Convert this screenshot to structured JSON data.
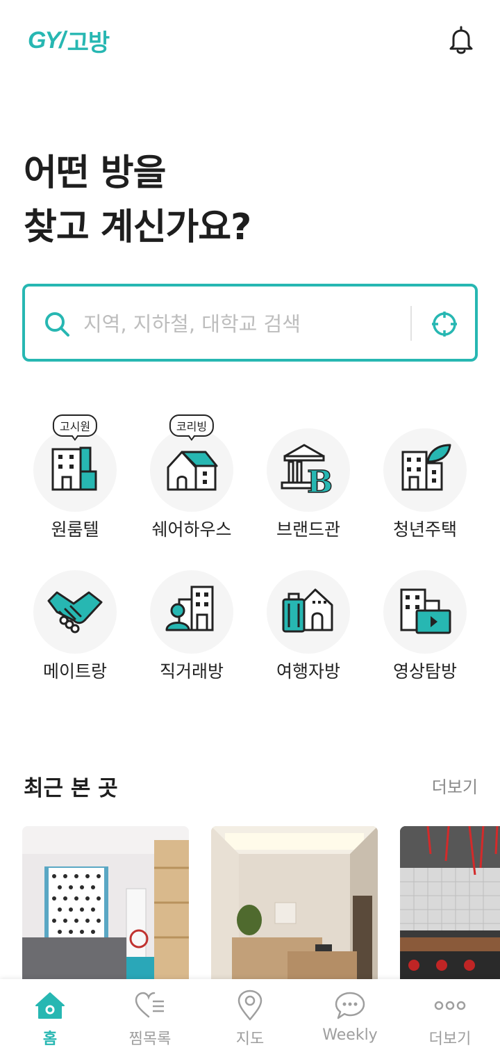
{
  "app": {
    "logo_mark": "GY/",
    "logo_text": "고방"
  },
  "colors": {
    "accent": "#27b7b2",
    "text_dark": "#1e1e1e",
    "text_muted": "#9e9e9e"
  },
  "header": {
    "bell_icon": "bell-icon"
  },
  "headline": {
    "line1": "어떤 방을",
    "line2": "찾고 계신가요?"
  },
  "search": {
    "placeholder": "지역, 지하철, 대학교 검색",
    "value": ""
  },
  "categories": [
    {
      "label": "원룸텔",
      "badge": "고시원",
      "icon": "building-icon"
    },
    {
      "label": "쉐어하우스",
      "badge": "코리빙",
      "icon": "house-icon"
    },
    {
      "label": "브랜드관",
      "badge": "",
      "icon": "brand-bank-icon"
    },
    {
      "label": "청년주택",
      "badge": "",
      "icon": "building-leaf-icon"
    },
    {
      "label": "메이트랑",
      "badge": "",
      "icon": "handshake-icon"
    },
    {
      "label": "직거래방",
      "badge": "",
      "icon": "person-building-icon"
    },
    {
      "label": "여행자방",
      "badge": "",
      "icon": "luggage-house-icon"
    },
    {
      "label": "영상탐방",
      "badge": "",
      "icon": "video-building-icon"
    }
  ],
  "recent": {
    "title": "최근 본 곳",
    "more": "더보기"
  },
  "tabs": [
    {
      "label": "홈",
      "icon": "home-icon",
      "active": true
    },
    {
      "label": "찜목록",
      "icon": "heart-list-icon",
      "active": false
    },
    {
      "label": "지도",
      "icon": "map-pin-icon",
      "active": false
    },
    {
      "label": "Weekly",
      "icon": "chat-bubble-icon",
      "active": false
    },
    {
      "label": "더보기",
      "icon": "more-dots-icon",
      "active": false
    }
  ]
}
